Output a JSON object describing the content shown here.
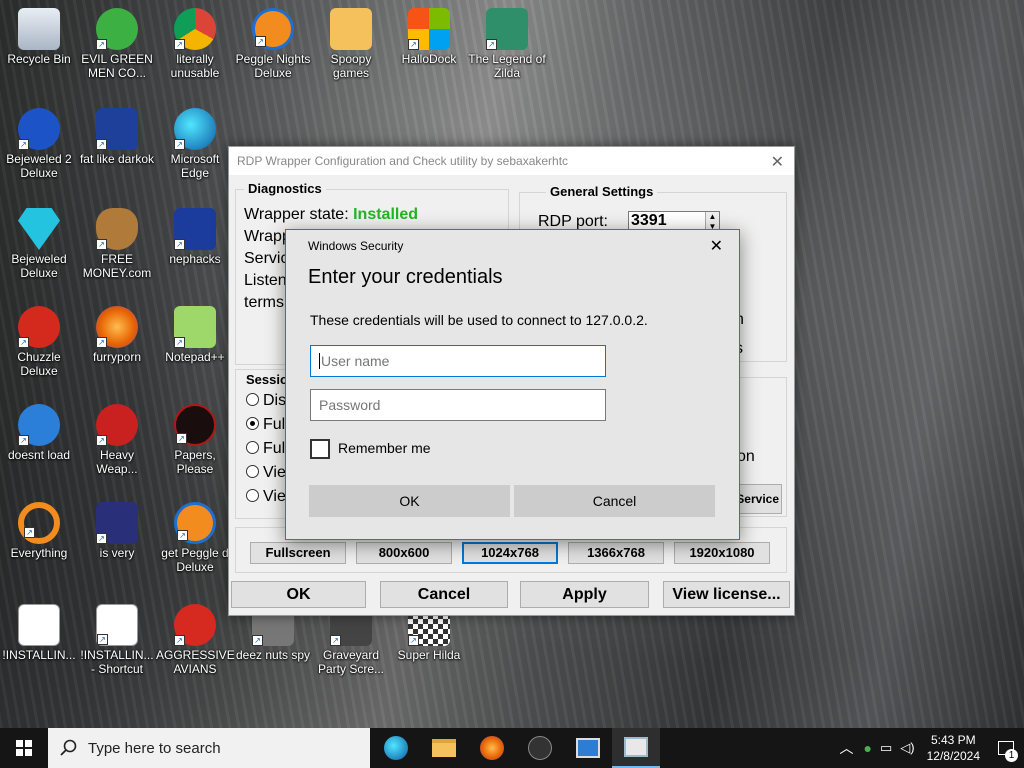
{
  "desktop": {
    "icons": [
      {
        "label": "Recycle Bin"
      },
      {
        "label": "EVIL GREEN MEN CO..."
      },
      {
        "label": "literally unusable"
      },
      {
        "label": "Peggle Nights Deluxe"
      },
      {
        "label": "Spoopy games"
      },
      {
        "label": "HalloDock"
      },
      {
        "label": "The Legend of Zilda"
      },
      {
        "label": "Bejeweled 2 Deluxe"
      },
      {
        "label": "fat like darkok"
      },
      {
        "label": "Microsoft Edge"
      },
      {
        "label": "Bejeweled Deluxe"
      },
      {
        "label": "FREE MONEY.com"
      },
      {
        "label": "nephacks"
      },
      {
        "label": "Chuzzle Deluxe"
      },
      {
        "label": "furryporn"
      },
      {
        "label": "Notepad++"
      },
      {
        "label": "doesnt load"
      },
      {
        "label": "Heavy Weap..."
      },
      {
        "label": "Papers, Please"
      },
      {
        "label": "Everything"
      },
      {
        "label": "is very"
      },
      {
        "label": "get Peggle d Deluxe"
      },
      {
        "label": "!INSTALLIN..."
      },
      {
        "label": "!INSTALLIN... - Shortcut"
      },
      {
        "label": "AGGRESSIVE AVIANS"
      },
      {
        "label": "deez nuts spy"
      },
      {
        "label": "Graveyard Party Scre..."
      },
      {
        "label": "Super Hilda"
      }
    ]
  },
  "rdp": {
    "title": "RDP Wrapper Configuration and Check utility by sebaxakerhtc",
    "diagnostics": {
      "title": "Diagnostics",
      "wrapper_state_label": "Wrapper state:",
      "wrapper_state_value": "Installed",
      "line2": "Wrapp",
      "line3": "Servic",
      "line4": "Listen",
      "line5": "terms"
    },
    "general": {
      "title": "General Settings",
      "port_label": "RDP port:",
      "port_value": "3391",
      "frag1": "n",
      "frag2": "s",
      "frag3": "on",
      "service_btn": "Service"
    },
    "session": {
      "title": "Sessio",
      "options": [
        "Dis",
        "Ful",
        "Ful",
        "Vie",
        "Vie"
      ]
    },
    "resolutions": [
      "Fullscreen",
      "800x600",
      "1024x768",
      "1366x768",
      "1920x1080"
    ],
    "buttons": {
      "ok": "OK",
      "cancel": "Cancel",
      "apply": "Apply",
      "license": "View license..."
    }
  },
  "security": {
    "window_title": "Windows Security",
    "heading": "Enter your credentials",
    "description": "These credentials will be used to connect to 127.0.0.2.",
    "username_placeholder": "User name",
    "password_placeholder": "Password",
    "remember_label": "Remember me",
    "ok_label": "OK",
    "cancel_label": "Cancel"
  },
  "taskbar": {
    "search_placeholder": "Type here to search",
    "time": "5:43 PM",
    "date": "12/8/2024",
    "notification_count": "1"
  },
  "colors": {
    "accent": "#0078d7",
    "installed_green": "#22b522"
  }
}
